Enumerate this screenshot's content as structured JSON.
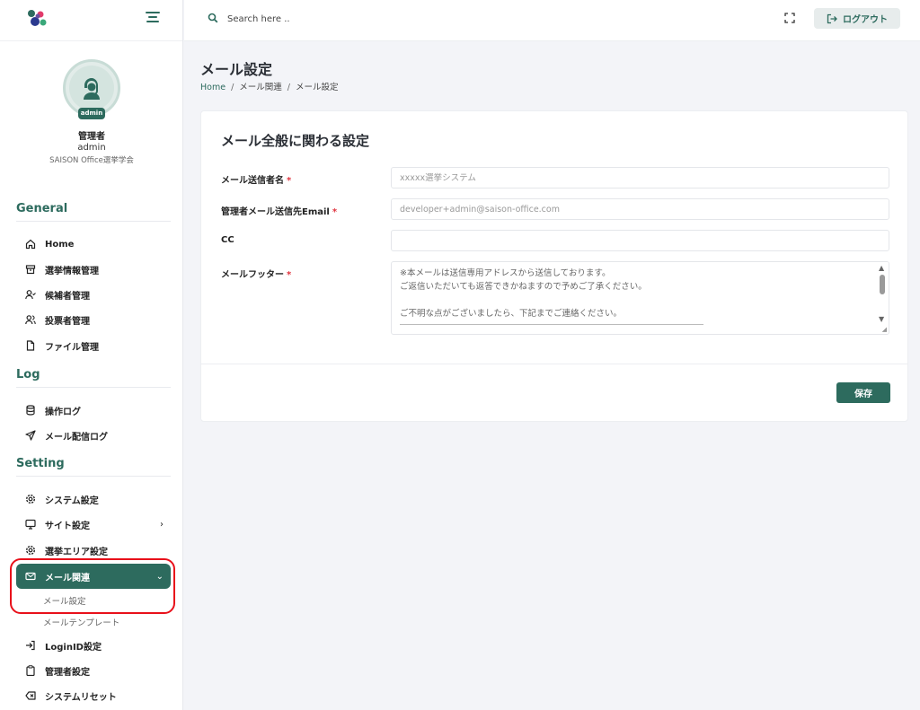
{
  "topbar": {
    "search_placeholder": "Search here ..",
    "logout_label": "ログアウト"
  },
  "profile": {
    "badge": "admin",
    "name": "管理者",
    "username": "admin",
    "organization": "SAISON Office選挙学会"
  },
  "sidebar": {
    "sections": {
      "general": "General",
      "log": "Log",
      "setting": "Setting"
    },
    "general_items": [
      "Home",
      "選挙情報管理",
      "候補者管理",
      "投票者管理",
      "ファイル管理"
    ],
    "log_items": [
      "操作ログ",
      "メール配信ログ"
    ],
    "setting_items": [
      "システム設定",
      "サイト設定",
      "選挙エリア設定",
      "メール関連",
      "LoginID設定",
      "管理者設定",
      "システムリセット"
    ],
    "mail_submenu": [
      "メール設定",
      "メールテンプレート"
    ],
    "active_item": "メール関連",
    "accent_color": "#2d6b5e",
    "highlight_color": "#e8101a"
  },
  "page": {
    "title": "メール設定",
    "breadcrumb": [
      "Home",
      "メール関連",
      "メール設定"
    ]
  },
  "form": {
    "title": "メール全般に関わる設定",
    "sender_name_label": "メール送信者名",
    "sender_name_placeholder": "xxxxx選挙システム",
    "admin_email_label": "管理者メール送信先Email",
    "admin_email_placeholder": "developer+admin@saison-office.com",
    "cc_label": "CC",
    "cc_value": "",
    "footer_label": "メールフッター",
    "footer_text": "※本メールは送信専用アドレスから送信しております。\nご返信いただいても返答できかねますので予めご了承ください。\n\nご不明な点がございましたら、下記までご連絡ください。\n\n　　xx選挙システム",
    "required_mark": "*",
    "save_label": "保存"
  }
}
